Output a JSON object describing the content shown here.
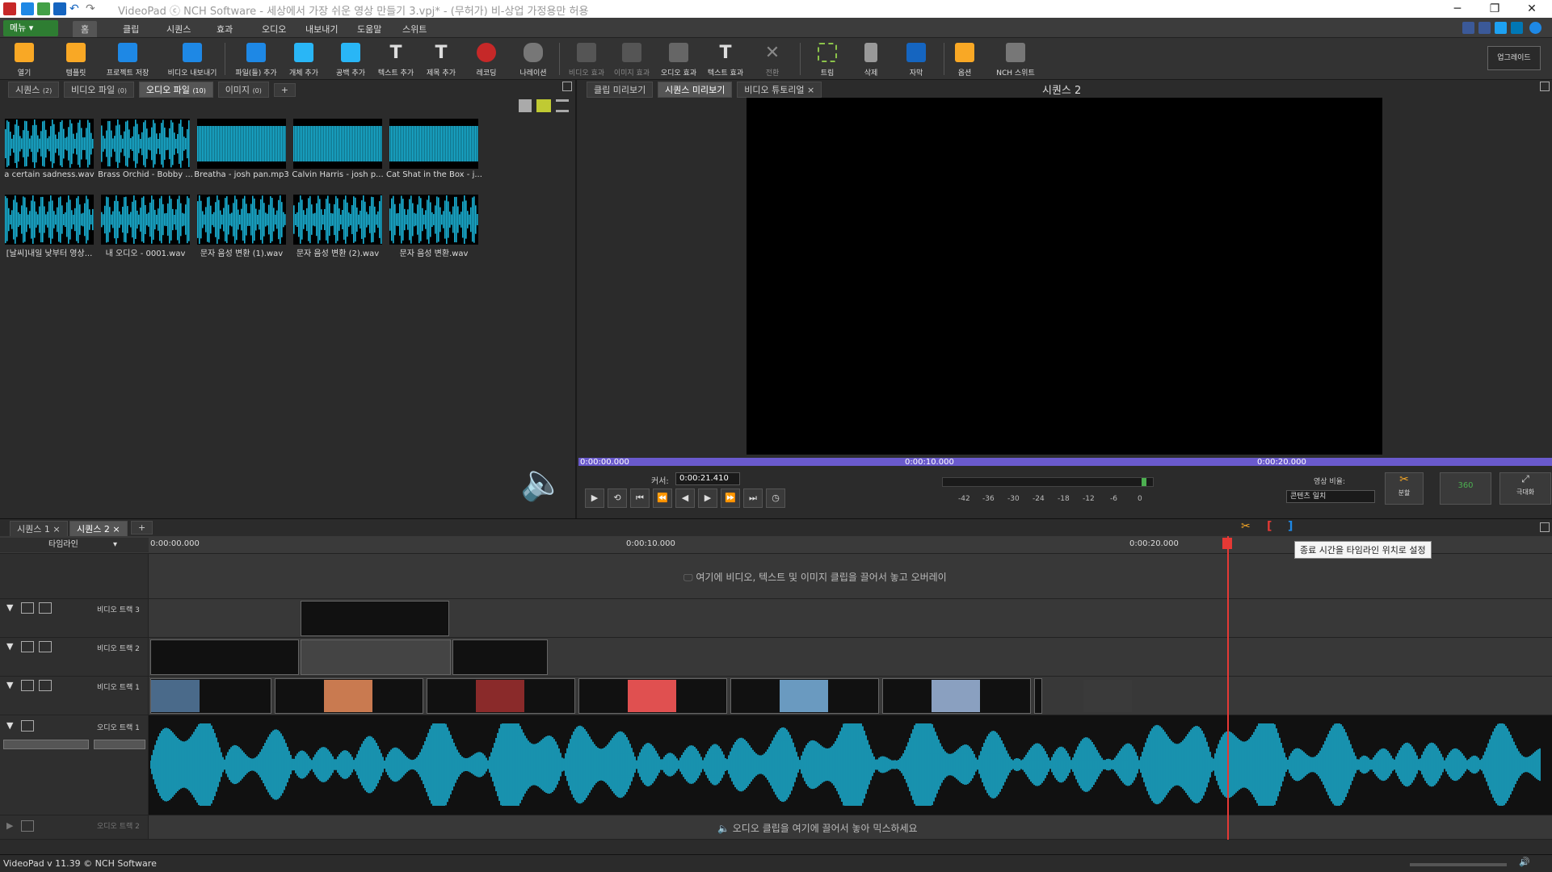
{
  "window": {
    "title": "VideoPad ⓒ NCH Software - 세상에서 가장 쉬운 영상 만들기 3.vpj* - (무허가) 비-상업 가정용만 허용",
    "minimize": "─",
    "restore": "❐",
    "close": "✕"
  },
  "menubar": {
    "menu_label": "메뉴 ▾",
    "tabs": [
      "홈",
      "클립",
      "시퀀스",
      "효과",
      "오디오",
      "내보내기",
      "도움말",
      "스위트"
    ],
    "active_tab": "홈"
  },
  "toolbar": {
    "buttons": [
      "열기",
      "템플릿",
      "프로젝트 저장",
      "비디오 내보내기",
      "파일(들) 추가",
      "개체 추가",
      "공백 추가",
      "텍스트 추가",
      "제목 추가",
      "레코딩",
      "나레이션",
      "비디오 효과",
      "이미지 효과",
      "오디오 효과",
      "텍스트 효과",
      "전환",
      "트림",
      "삭제",
      "자막",
      "옵션",
      "NCH 스위트"
    ],
    "upgrade": "업그레이드"
  },
  "media_panel": {
    "tabs": [
      "시퀀스",
      "비디오 파일",
      "오디오 파일",
      "이미지"
    ],
    "tab_counts": [
      "(2)",
      "(0)",
      "(10)",
      "(0)"
    ],
    "active_tab": "오디오 파일",
    "add_tab": "+",
    "files": [
      "a certain sadness.wav",
      "Brass Orchid - Bobby ...",
      "Breatha - josh pan.mp3",
      "Calvin Harris - josh p...",
      "Cat Shat in the Box - j...",
      "[날씨]내일 낮부터 영상...",
      "내 오디오 - 0001.wav",
      "문자 음성 변환 (1).wav",
      "문자 음성 변환 (2).wav",
      "문자 음성 변환.wav"
    ]
  },
  "preview": {
    "tabs": [
      "클립 미리보기",
      "시퀀스 미리보기",
      "비디오 튜토리얼"
    ],
    "active_tab": "시퀀스 미리보기",
    "sequence_title": "시퀀스 2",
    "scrub_times": [
      "0:00:00.000",
      "0:00:10.000",
      "0:00:20.000"
    ],
    "cursor_label": "커서:",
    "cursor_value": "0:00:21.410",
    "meter_labels": [
      "-42",
      "-36",
      "-30",
      "-24",
      "-18",
      "-12",
      "-6",
      "0"
    ],
    "aspect_label": "영상 비율:",
    "aspect_value": "콘텐츠 일치",
    "split_label": "분할",
    "vr_label": "360",
    "fullscreen_label": "극대화"
  },
  "timeline": {
    "seq_tabs": [
      "시퀀스 1",
      "시퀀스 2"
    ],
    "active_seq": "시퀀스 2",
    "add_tab": "+",
    "view_label": "타임라인",
    "ruler_times": [
      "0:00:00.000",
      "0:00:10.000",
      "0:00:20.000"
    ],
    "overlay_hint": "여기에 비디오, 텍스트 및 이미지 클립을 끌어서 놓고 오버레이",
    "audio_hint": "오디오 클립을 여기에 끌어서 놓아 믹스하세요",
    "tooltip": "종료 시간을 타임라인 위치로 설정",
    "tracks": {
      "video3": "비디오 트랙 3",
      "video2": "비디오 트랙 2",
      "video1": "비디오 트랙 1",
      "audio1": "오디오 트랙 1",
      "audio2": "오디오 트랙 2"
    }
  },
  "statusbar": {
    "version": "VideoPad v 11.39 © NCH Software"
  },
  "colors": {
    "accent": "#2e7d32",
    "waveform": "#1ab2d6",
    "playhead": "#e53935",
    "scrubbar": "#6a5acd"
  }
}
